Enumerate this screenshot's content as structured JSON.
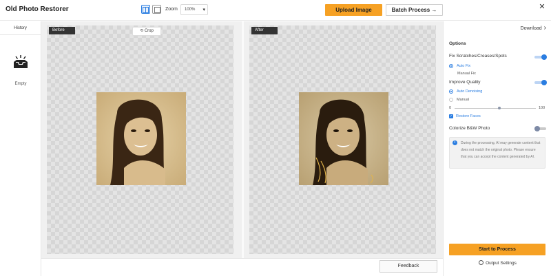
{
  "header": {
    "app_title": "Old Photo Restorer",
    "zoom_label": "Zoom",
    "zoom_value": "100%",
    "upload_label": "Upload Image",
    "batch_label": "Batch Process →",
    "close_glyph": "✕"
  },
  "history": {
    "tab_label": "History",
    "empty_label": "Empty"
  },
  "canvas": {
    "before_label": "Before",
    "after_label": "After",
    "crop_label": "Crop",
    "crop_glyph": "⟲"
  },
  "bottom": {
    "feedback_label": "Feedback"
  },
  "options": {
    "download_label": "Download",
    "title": "Options",
    "fix_scratches": {
      "label": "Fix Scratches/Creases/Spots",
      "enabled": true
    },
    "fix_modes": [
      {
        "label": "Auto Fix",
        "selected": true
      },
      {
        "label": "Manual Fix",
        "selected": false
      }
    ],
    "improve_quality": {
      "label": "Improve Quality",
      "enabled": true
    },
    "denoise_modes": [
      {
        "label": "Auto Denoising",
        "selected": true
      },
      {
        "label": "Manual",
        "selected": false
      }
    ],
    "slider": {
      "min_label": "0",
      "max_label": "100",
      "value": 55
    },
    "restore_faces": {
      "label": "Restore Faces",
      "checked": true
    },
    "colorize": {
      "label": "Colorize B&W Photo",
      "enabled": false
    },
    "notice": "During the processing, AI may generate content that does not match the original photo. Please ensure that you can accept the content generated by AI.",
    "process_label": "Start to Process",
    "output_settings_label": "Output Settings"
  },
  "colors": {
    "accent": "#f6a124",
    "blue": "#2a7de1"
  }
}
